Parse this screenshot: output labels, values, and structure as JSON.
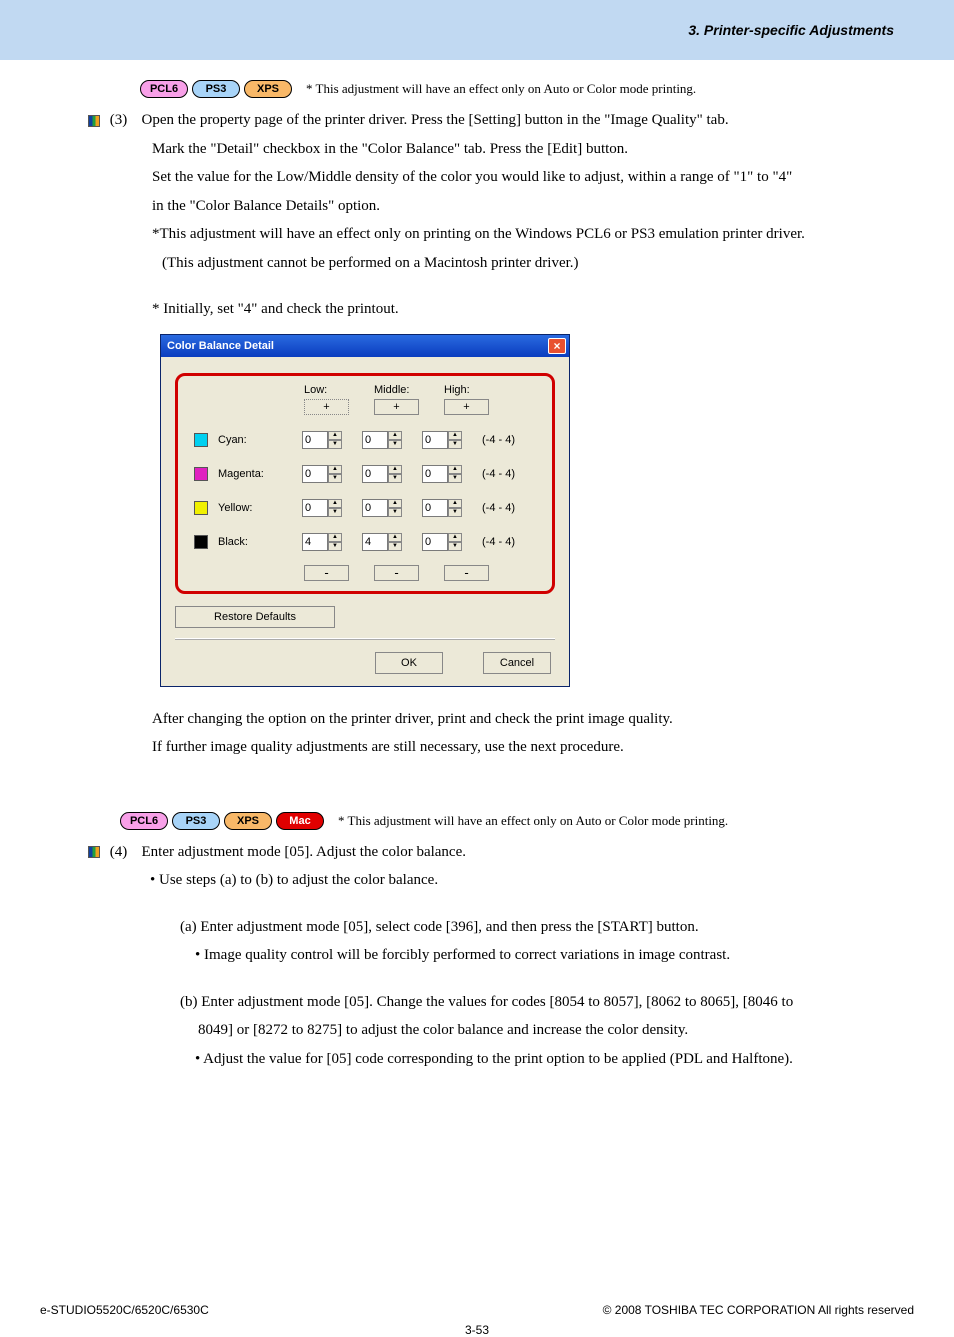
{
  "header": {
    "section_title": "3. Printer-specific Adjustments"
  },
  "pills": {
    "pcl6": "PCL6",
    "ps3": "PS3",
    "xps": "XPS",
    "mac": "Mac"
  },
  "notes": {
    "effect_note": "* This adjustment will have an effect only on Auto or Color mode printing."
  },
  "step3": {
    "num": "(3)",
    "l1": "Open the property page of the printer driver.  Press the [Setting] button in the \"Image Quality\" tab.",
    "l2": "Mark the \"Detail\" checkbox in the \"Color Balance\" tab.  Press the [Edit] button.",
    "l3": "Set the value for the Low/Middle density of the color you would like to adjust, within a range of \"1\" to \"4\"",
    "l4": "in the \"Color Balance Details\" option.",
    "l5": "*This adjustment will have an effect only on printing on the Windows PCL6 or PS3 emulation printer driver.",
    "l6": "(This adjustment cannot be performed on a Macintosh printer driver.)",
    "l7": "* Initially, set \"4\" and check the printout."
  },
  "dialog": {
    "title": "Color Balance Detail",
    "cols": {
      "low": "Low:",
      "mid": "Middle:",
      "high": "High:"
    },
    "plus": "+",
    "minus": "-",
    "colors": {
      "cyan": "Cyan:",
      "magenta": "Magenta:",
      "yellow": "Yellow:",
      "black": "Black:"
    },
    "range": "(-4 - 4)",
    "values": {
      "cyan": {
        "low": "0",
        "mid": "0",
        "high": "0"
      },
      "magenta": {
        "low": "0",
        "mid": "0",
        "high": "0"
      },
      "yellow": {
        "low": "0",
        "mid": "0",
        "high": "0"
      },
      "black": {
        "low": "4",
        "mid": "4",
        "high": "0"
      }
    },
    "restore": "Restore Defaults",
    "ok": "OK",
    "cancel": "Cancel"
  },
  "after": {
    "l1": "After changing the option on the printer driver, print and check the print image quality.",
    "l2": "If further image quality adjustments are still necessary, use the next procedure."
  },
  "step4": {
    "num": "(4)",
    "l1": "Enter adjustment mode [05].  Adjust the color balance.",
    "b1": "• Use steps (a) to (b) to adjust the color balance.",
    "a1": "(a) Enter adjustment mode [05], select code [396], and then press the [START] button.",
    "a2": "• Image quality control will be forcibly performed to correct variations in image contrast.",
    "b1b": "(b) Enter adjustment mode [05].  Change the values for codes [8054 to 8057], [8062 to 8065], [8046 to",
    "b1c": "8049] or [8272 to 8275] to adjust the color balance and increase the color density.",
    "b2": "•  Adjust the value for [05] code corresponding to the print option to be applied (PDL and Halftone)."
  },
  "footer": {
    "left": "e-STUDIO5520C/6520C/6530C",
    "right": "© 2008 TOSHIBA TEC CORPORATION All rights reserved",
    "page": "3-53"
  }
}
